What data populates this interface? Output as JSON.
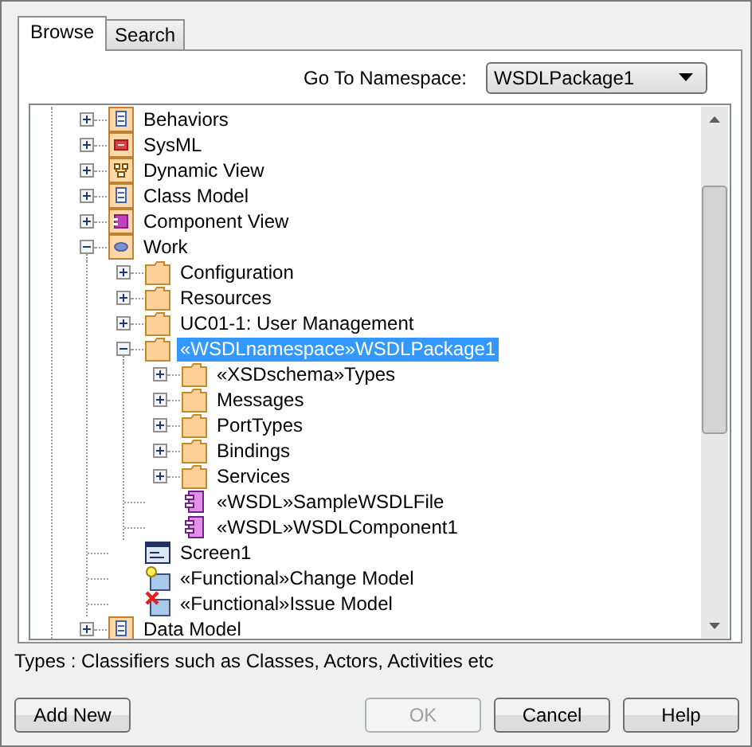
{
  "tabs": [
    {
      "label": "Browse",
      "selected": true
    },
    {
      "label": "Search",
      "selected": false
    }
  ],
  "namespace": {
    "label": "Go To Namespace:",
    "value": "WSDLPackage1"
  },
  "tree": [
    {
      "label": "Behaviors",
      "kind": "behavior-package",
      "expandable": true,
      "expanded": false,
      "selected": false
    },
    {
      "label": "SysML",
      "kind": "sysml-package",
      "expandable": true,
      "expanded": false,
      "selected": false
    },
    {
      "label": "Dynamic View",
      "kind": "dynamic-package",
      "expandable": true,
      "expanded": false,
      "selected": false
    },
    {
      "label": "Class Model",
      "kind": "class-package",
      "expandable": true,
      "expanded": false,
      "selected": false
    },
    {
      "label": "Component View",
      "kind": "component-package",
      "expandable": true,
      "expanded": false,
      "selected": false
    },
    {
      "label": "Work",
      "kind": "work-package",
      "expandable": true,
      "expanded": true,
      "selected": false,
      "children": [
        {
          "label": "Configuration",
          "kind": "folder",
          "expandable": true,
          "expanded": false,
          "selected": false
        },
        {
          "label": "Resources",
          "kind": "folder",
          "expandable": true,
          "expanded": false,
          "selected": false
        },
        {
          "label": "UC01-1: User Management",
          "kind": "folder",
          "expandable": true,
          "expanded": false,
          "selected": false
        },
        {
          "label": "«WSDLnamespace»WSDLPackage1",
          "kind": "folder",
          "expandable": true,
          "expanded": true,
          "selected": true,
          "children": [
            {
              "label": "«XSDschema»Types",
              "kind": "folder",
              "expandable": true,
              "expanded": false,
              "selected": false
            },
            {
              "label": "Messages",
              "kind": "folder",
              "expandable": true,
              "expanded": false,
              "selected": false
            },
            {
              "label": "PortTypes",
              "kind": "folder",
              "expandable": true,
              "expanded": false,
              "selected": false
            },
            {
              "label": "Bindings",
              "kind": "folder",
              "expandable": true,
              "expanded": false,
              "selected": false
            },
            {
              "label": "Services",
              "kind": "folder",
              "expandable": true,
              "expanded": false,
              "selected": false
            },
            {
              "label": "«WSDL»SampleWSDLFile",
              "kind": "component",
              "expandable": false,
              "selected": false
            },
            {
              "label": "«WSDL»WSDLComponent1",
              "kind": "component",
              "expandable": false,
              "selected": false
            }
          ]
        },
        {
          "label": "Screen1",
          "kind": "screen",
          "expandable": false,
          "selected": false
        },
        {
          "label": "«Functional»Change Model",
          "kind": "change",
          "expandable": false,
          "selected": false
        },
        {
          "label": "«Functional»Issue Model",
          "kind": "issue",
          "expandable": false,
          "selected": false
        }
      ]
    },
    {
      "label": "Data Model",
      "kind": "class-package",
      "expandable": true,
      "expanded": false,
      "selected": false
    }
  ],
  "description": "Types : Classifiers such as Classes, Actors, Activities etc",
  "buttons": [
    {
      "label": "Add New",
      "disabled": false
    },
    {
      "label": "OK",
      "disabled": true
    },
    {
      "label": "Cancel",
      "disabled": false
    },
    {
      "label": "Help",
      "disabled": false
    }
  ]
}
